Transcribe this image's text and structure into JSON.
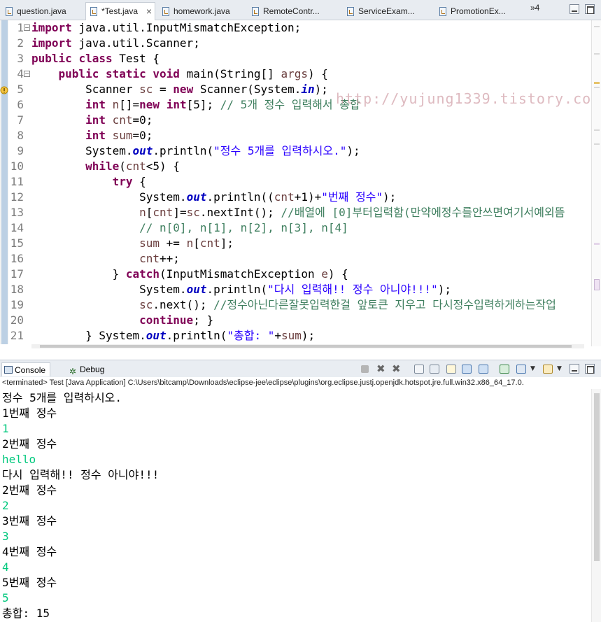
{
  "tabs": [
    {
      "label": "question.java",
      "active": false
    },
    {
      "label": "*Test.java",
      "active": true
    },
    {
      "label": "homework.java",
      "active": false
    },
    {
      "label": "RemoteContr...",
      "active": false
    },
    {
      "label": "ServiceExam...",
      "active": false
    },
    {
      "label": "PromotionEx...",
      "active": false
    }
  ],
  "tab_overflow": "»4",
  "editor": {
    "line_numbers": [
      "1",
      "2",
      "3",
      "4",
      "5",
      "6",
      "7",
      "8",
      "9",
      "10",
      "11",
      "12",
      "13",
      "14",
      "15",
      "16",
      "17",
      "18",
      "19",
      "20",
      "21"
    ],
    "lines": [
      [
        [
          "kw",
          "import"
        ],
        [
          "t",
          " java.util.InputMismatchException;"
        ]
      ],
      [
        [
          "kw",
          "import"
        ],
        [
          "t",
          " java.util.Scanner;"
        ]
      ],
      [
        [
          "kw",
          "public"
        ],
        [
          "t",
          " "
        ],
        [
          "kw",
          "class"
        ],
        [
          "t",
          " Test {"
        ]
      ],
      [
        [
          "t",
          "    "
        ],
        [
          "kw",
          "public"
        ],
        [
          "t",
          " "
        ],
        [
          "kw",
          "static"
        ],
        [
          "t",
          " "
        ],
        [
          "kw",
          "void"
        ],
        [
          "t",
          " main(String[] "
        ],
        [
          "local",
          "args"
        ],
        [
          "t",
          ") {"
        ]
      ],
      [
        [
          "t",
          "        Scanner "
        ],
        [
          "local",
          "sc"
        ],
        [
          "t",
          " = "
        ],
        [
          "kw",
          "new"
        ],
        [
          "t",
          " Scanner(System."
        ],
        [
          "fld",
          "in"
        ],
        [
          "t",
          ");"
        ]
      ],
      [
        [
          "t",
          "        "
        ],
        [
          "kw",
          "int"
        ],
        [
          "t",
          " "
        ],
        [
          "local",
          "n"
        ],
        [
          "t",
          "[]="
        ],
        [
          "kw",
          "new"
        ],
        [
          "t",
          " "
        ],
        [
          "kw",
          "int"
        ],
        [
          "t",
          "[5]; "
        ],
        [
          "cmt",
          "// 5개 정수 입력해서 총합"
        ]
      ],
      [
        [
          "t",
          "        "
        ],
        [
          "kw",
          "int"
        ],
        [
          "t",
          " "
        ],
        [
          "local",
          "cnt"
        ],
        [
          "t",
          "=0;"
        ]
      ],
      [
        [
          "t",
          "        "
        ],
        [
          "kw",
          "int"
        ],
        [
          "t",
          " "
        ],
        [
          "local",
          "sum"
        ],
        [
          "t",
          "=0;"
        ]
      ],
      [
        [
          "t",
          "        System."
        ],
        [
          "fld",
          "out"
        ],
        [
          "t",
          ".println("
        ],
        [
          "str",
          "\"정수 5개를 입력하시오.\""
        ],
        [
          "t",
          ");"
        ]
      ],
      [
        [
          "t",
          "        "
        ],
        [
          "kw",
          "while"
        ],
        [
          "t",
          "("
        ],
        [
          "local",
          "cnt"
        ],
        [
          "t",
          "<5) {"
        ]
      ],
      [
        [
          "t",
          "            "
        ],
        [
          "kw",
          "try"
        ],
        [
          "t",
          " {"
        ]
      ],
      [
        [
          "t",
          "                System."
        ],
        [
          "fld",
          "out"
        ],
        [
          "t",
          ".println(("
        ],
        [
          "local",
          "cnt"
        ],
        [
          "t",
          "+1)+"
        ],
        [
          "str",
          "\"번째 정수\""
        ],
        [
          "t",
          ");"
        ]
      ],
      [
        [
          "t",
          "                "
        ],
        [
          "local",
          "n"
        ],
        [
          "t",
          "["
        ],
        [
          "local",
          "cnt"
        ],
        [
          "t",
          "]="
        ],
        [
          "local",
          "sc"
        ],
        [
          "t",
          ".nextInt(); "
        ],
        [
          "cmt",
          "//배열에 [0]부터입력함(만약에정수를안쓰면여기서예외뜸"
        ]
      ],
      [
        [
          "t",
          "                "
        ],
        [
          "cmt",
          "// n[0], n[1], n[2], n[3], n[4]"
        ]
      ],
      [
        [
          "t",
          "                "
        ],
        [
          "local",
          "sum"
        ],
        [
          "t",
          " += "
        ],
        [
          "local",
          "n"
        ],
        [
          "t",
          "["
        ],
        [
          "local",
          "cnt"
        ],
        [
          "t",
          "];"
        ]
      ],
      [
        [
          "t",
          "                "
        ],
        [
          "local",
          "cnt"
        ],
        [
          "t",
          "++;"
        ]
      ],
      [
        [
          "t",
          "            } "
        ],
        [
          "kw",
          "catch"
        ],
        [
          "t",
          "(InputMismatchException "
        ],
        [
          "local",
          "e"
        ],
        [
          "t",
          ") {"
        ]
      ],
      [
        [
          "t",
          "                System."
        ],
        [
          "fld",
          "out"
        ],
        [
          "t",
          ".println("
        ],
        [
          "str",
          "\"다시 입력해!! 정수 아니야!!!\""
        ],
        [
          "t",
          ");"
        ]
      ],
      [
        [
          "t",
          "                "
        ],
        [
          "local",
          "sc"
        ],
        [
          "t",
          ".next(); "
        ],
        [
          "cmt",
          "//정수아닌다른잘못입력한걸 앞토큰 지우고 다시정수입력하게하는작업"
        ]
      ],
      [
        [
          "t",
          "                "
        ],
        [
          "kw",
          "continue"
        ],
        [
          "t",
          "; }"
        ]
      ],
      [
        [
          "t",
          "        } System."
        ],
        [
          "fld",
          "out"
        ],
        [
          "t",
          ".println("
        ],
        [
          "str",
          "\"총합: \""
        ],
        [
          "t",
          "+"
        ],
        [
          "local",
          "sum"
        ],
        [
          "t",
          ");"
        ]
      ]
    ],
    "watermark": "http://yujung1339.tistory.com/"
  },
  "console": {
    "tabs": [
      {
        "label": "Console",
        "icon": "console-icon",
        "active": true
      },
      {
        "label": "Debug",
        "icon": "bug-icon",
        "active": false
      }
    ],
    "status": "<terminated> Test [Java Application] C:\\Users\\bitcamp\\Downloads\\eclipse-jee\\eclipse\\plugins\\org.eclipse.justj.openjdk.hotspot.jre.full.win32.x86_64_17.0.",
    "output": [
      {
        "text": "정수 5개를 입력하시오.",
        "input": false
      },
      {
        "text": "1번째 정수",
        "input": false
      },
      {
        "text": "1",
        "input": true
      },
      {
        "text": "2번째 정수",
        "input": false
      },
      {
        "text": "hello",
        "input": true
      },
      {
        "text": "다시 입력해!! 정수 아니야!!!",
        "input": false
      },
      {
        "text": "2번째 정수",
        "input": false
      },
      {
        "text": "2",
        "input": true
      },
      {
        "text": "3번째 정수",
        "input": false
      },
      {
        "text": "3",
        "input": true
      },
      {
        "text": "4번째 정수",
        "input": false
      },
      {
        "text": "4",
        "input": true
      },
      {
        "text": "5번째 정수",
        "input": false
      },
      {
        "text": "5",
        "input": true
      },
      {
        "text": "총합: 15",
        "input": false
      }
    ]
  },
  "colors": {
    "keyword": "#7f0055",
    "string": "#2a00ff",
    "comment": "#3f7f5f",
    "field": "#0000c0",
    "console_input": "#00c87d"
  }
}
